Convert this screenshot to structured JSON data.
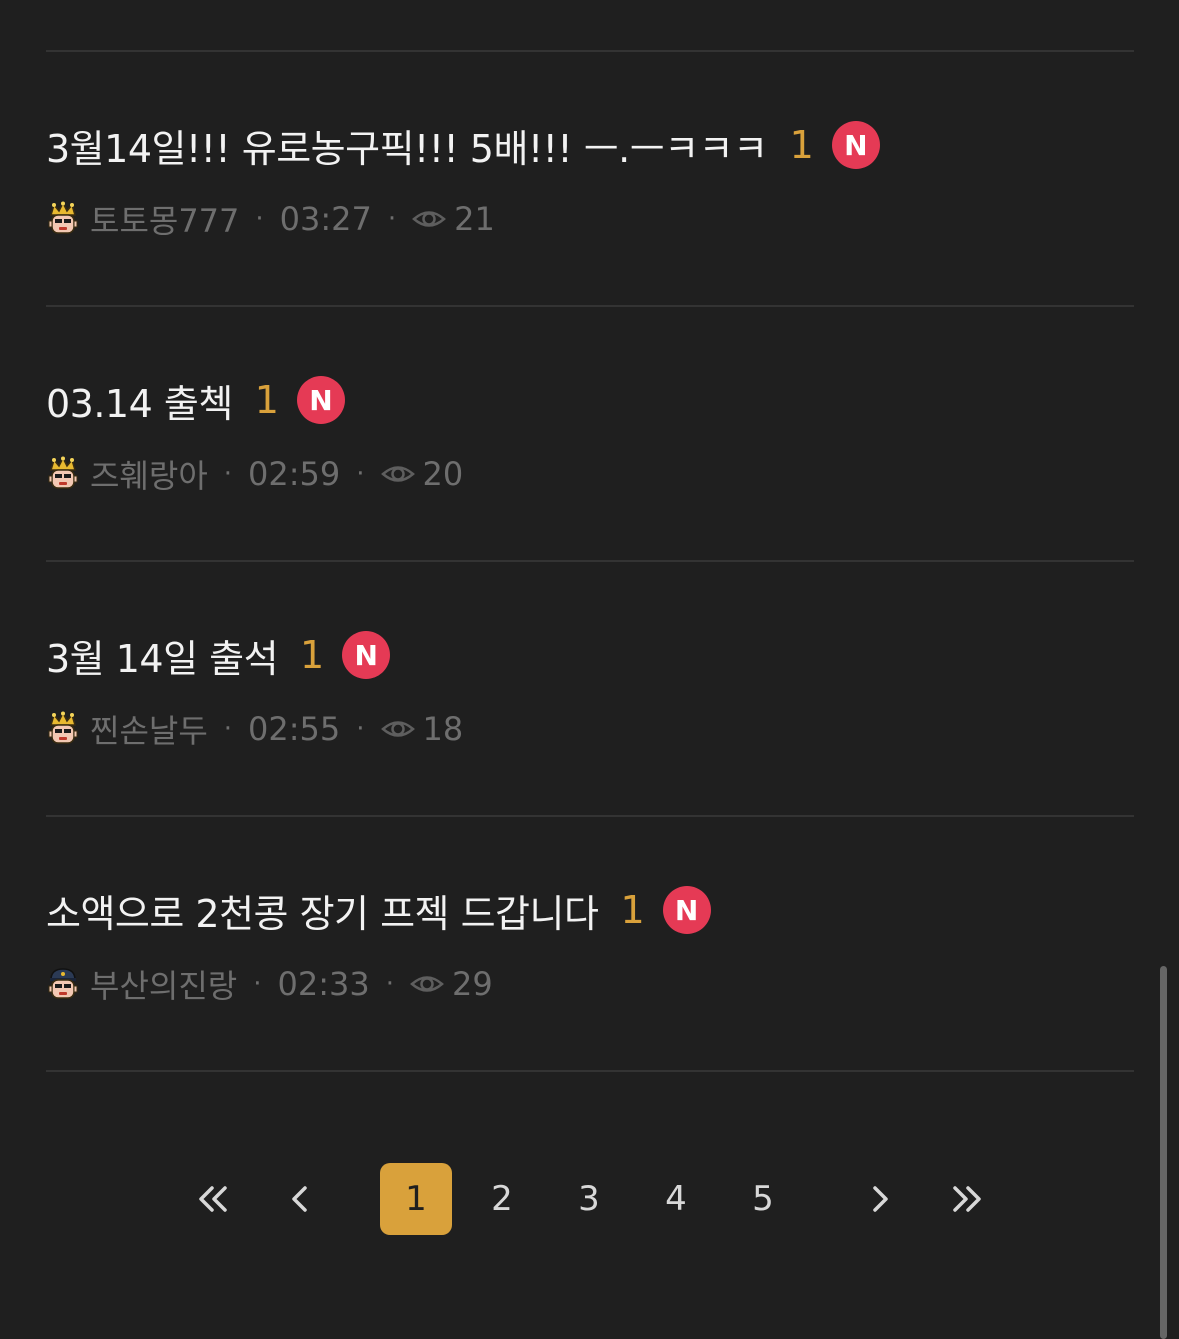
{
  "posts": [
    {
      "title": "3월14일!!! 유로농구픽!!! 5배!!! ㅡ.ㅡㅋㅋㅋ",
      "comment_count": "1",
      "new_badge": "N",
      "author": "토토몽777",
      "time": "03:27",
      "views": "21",
      "avatar_icon": "crowned-character-avatar-icon"
    },
    {
      "title": "03.14 출첵",
      "comment_count": "1",
      "new_badge": "N",
      "author": "즈훼랑아",
      "time": "02:59",
      "views": "20",
      "avatar_icon": "crowned-character-avatar-icon"
    },
    {
      "title": "3월 14일 출석",
      "comment_count": "1",
      "new_badge": "N",
      "author": "찐손날두",
      "time": "02:55",
      "views": "18",
      "avatar_icon": "crowned-character-avatar-icon"
    },
    {
      "title": "소액으로 2천콩 장기 프젝 드갑니다",
      "comment_count": "1",
      "new_badge": "N",
      "author": "부산의진랑",
      "time": "02:33",
      "views": "29",
      "avatar_icon": "capped-character-avatar-icon"
    }
  ],
  "meta_separator": "·",
  "pagination": {
    "first_icon": "double-chevron-left-icon",
    "prev_icon": "chevron-left-icon",
    "pages": [
      "1",
      "2",
      "3",
      "4",
      "5"
    ],
    "active_page": "1",
    "next_icon": "chevron-right-icon",
    "last_icon": "double-chevron-right-icon"
  },
  "colors": {
    "background": "#1f1f1f",
    "title_text": "#f2f2f2",
    "meta_text": "#6e6e6e",
    "accent": "#d9a13b",
    "new_badge": "#e53a55",
    "divider": "#333333"
  }
}
